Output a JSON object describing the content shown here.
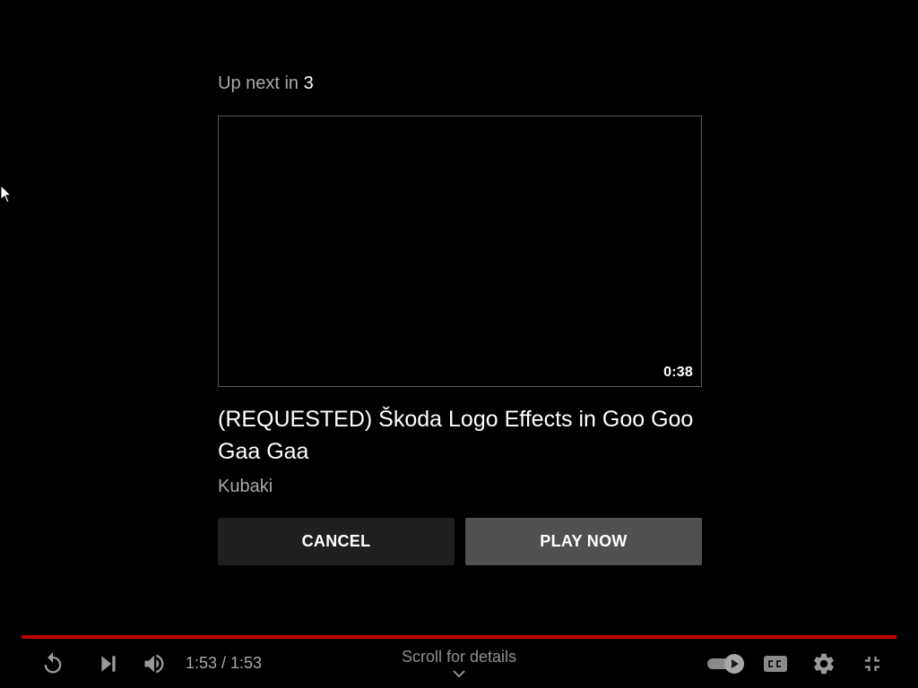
{
  "up_next": {
    "prefix": "Up next in",
    "countdown": "3",
    "video": {
      "duration": "0:38",
      "title": "(REQUESTED) Škoda Logo Effects in Goo Goo Gaa Gaa",
      "channel": "Kubaki"
    },
    "cancel_label": "CANCEL",
    "play_now_label": "PLAY NOW"
  },
  "player": {
    "progress_fraction": 1.0,
    "progress_color": "#c00000",
    "time_display": "1:53 / 1:53",
    "scroll_hint": "Scroll for details"
  },
  "icons": {
    "replay": "replay-icon",
    "next": "next-icon",
    "volume": "volume-icon",
    "autoplay": "autoplay-toggle-icon",
    "captions": "captions-icon",
    "settings": "gear-icon",
    "exit_fullscreen": "exit-fullscreen-icon",
    "chevron": "chevron-down-icon",
    "cursor": "mouse-pointer-icon"
  }
}
